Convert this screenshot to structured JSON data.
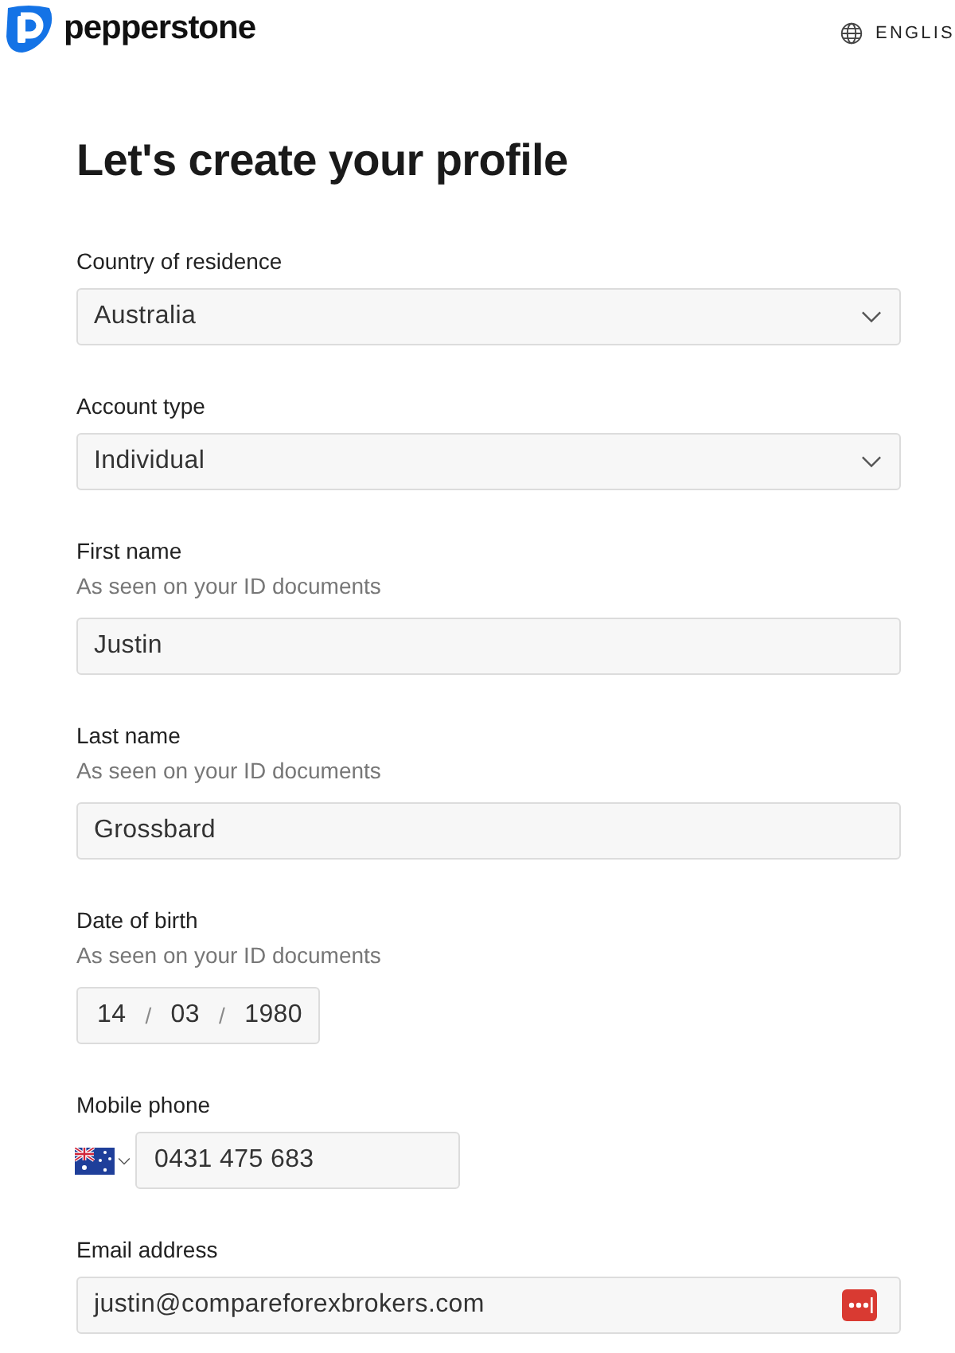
{
  "header": {
    "brand": "pepperstone",
    "language": "ENGLIS"
  },
  "title": "Let's create your profile",
  "fields": [
    {
      "kind": "select",
      "label": "Country of residence",
      "value": "Australia"
    },
    {
      "kind": "select",
      "label": "Account type",
      "value": "Individual"
    },
    {
      "kind": "text",
      "label": "First name",
      "hint": "As seen on your ID documents",
      "value": "Justin"
    },
    {
      "kind": "text",
      "label": "Last name",
      "hint": "As seen on your ID documents",
      "value": "Grossbard"
    },
    {
      "kind": "date",
      "label": "Date of birth",
      "hint": "As seen on your ID documents",
      "parts": [
        {
          "kind": "value",
          "text": "14"
        },
        {
          "kind": "separator",
          "text": "/"
        },
        {
          "kind": "value",
          "text": "03"
        },
        {
          "kind": "separator",
          "text": "/"
        },
        {
          "kind": "value",
          "text": "1980"
        }
      ]
    },
    {
      "kind": "phone",
      "label": "Mobile phone",
      "value": "0431 475 683"
    },
    {
      "kind": "email",
      "label": "Email address",
      "value": "justin@compareforexbrokers.com"
    }
  ]
}
